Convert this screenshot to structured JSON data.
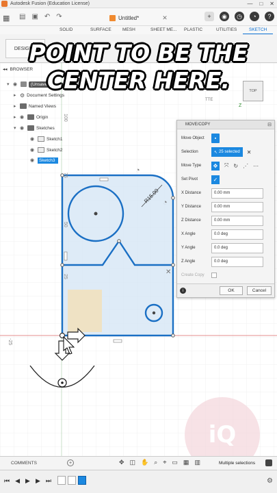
{
  "window": {
    "title": "Autodesk Fusion (Education License)",
    "controls": [
      "—",
      "□",
      "✕"
    ]
  },
  "document_tab": {
    "label": "Untitled*",
    "close": "✕"
  },
  "ribbon": {
    "tabs": [
      "SOLID",
      "SURFACE",
      "MESH",
      "SHEET ME...",
      "PLASTIC",
      "UTILITIES",
      "SKETCH"
    ],
    "active_tab": "SKETCH",
    "workspace_button": "DESIGN ▾"
  },
  "overlay_caption": {
    "line1": "POINT TO BE THE",
    "line2": "CENTER HERE."
  },
  "browser": {
    "header": "BROWSER",
    "items": [
      {
        "label": "(Unsaved)",
        "kind": "root"
      },
      {
        "label": "Document Settings",
        "kind": "settings"
      },
      {
        "label": "Named Views",
        "kind": "folder"
      },
      {
        "label": "Origin",
        "kind": "folder"
      },
      {
        "label": "Sketches",
        "kind": "folder"
      },
      {
        "label": "Sketch1",
        "kind": "sketch"
      },
      {
        "label": "Sketch2",
        "kind": "sketch"
      },
      {
        "label": "Sketch3",
        "kind": "sketch",
        "selected": true
      }
    ]
  },
  "viewcube": {
    "label": "TOP"
  },
  "canvas_labels": {
    "top_dim": "75",
    "left_dim_1": "50",
    "left_dim_2": "25",
    "left_dim_3": "100",
    "axis_value": "-25",
    "radius": "R15.00",
    "sketch_palette": "TTE",
    "z_label": "Z"
  },
  "move_copy": {
    "title": "MOVE/COPY",
    "move_object_label": "Move Object",
    "selection_label": "Selection",
    "selection_value": "25 selected",
    "move_type_label": "Move Type",
    "set_pivot_label": "Set Pivot",
    "fields": [
      {
        "label": "X Distance",
        "value": "0.00 mm"
      },
      {
        "label": "Y Distance",
        "value": "0.00 mm"
      },
      {
        "label": "Z Distance",
        "value": "0.00 mm"
      },
      {
        "label": "X Angle",
        "value": "0.0 deg"
      },
      {
        "label": "Y Angle",
        "value": "0.0 deg"
      },
      {
        "label": "Z Angle",
        "value": "0.0 deg"
      }
    ],
    "create_copy_label": "Create Copy",
    "ok_label": "OK",
    "cancel_label": "Cancel"
  },
  "bottom_bar": {
    "comments_label": "COMMENTS",
    "status": "Multiple selections"
  },
  "watermark": "iQ",
  "colors": {
    "accent": "#1b88e0",
    "sketch_line": "#1a6fc4",
    "selection_fill": "#d8e8f6",
    "watermark": "#f4d6dc"
  }
}
